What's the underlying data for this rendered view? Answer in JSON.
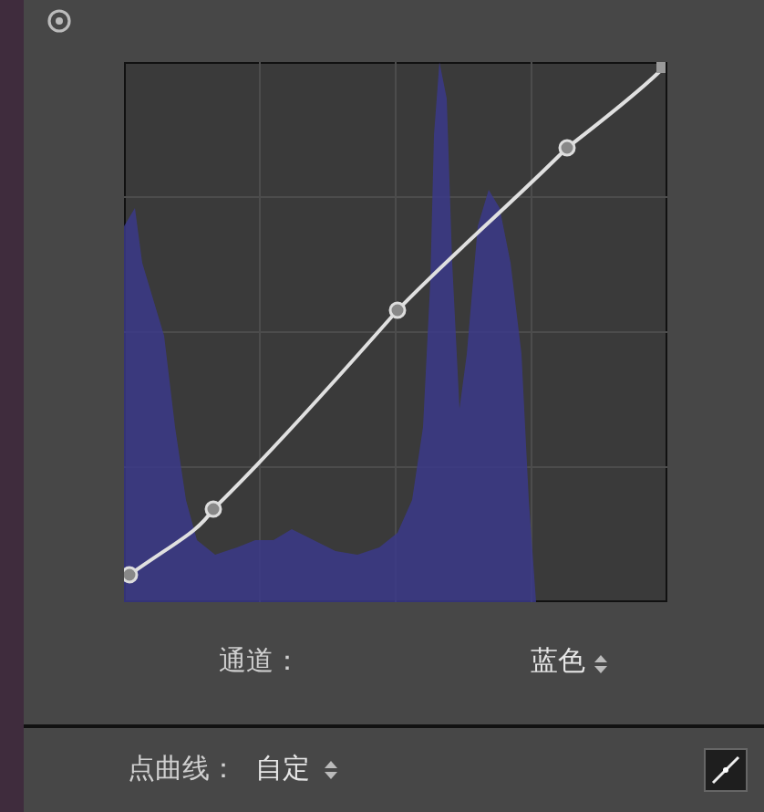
{
  "channel": {
    "label": "通道：",
    "value": "蓝色"
  },
  "point_curve": {
    "label": "点曲线：",
    "value": "自定"
  }
}
